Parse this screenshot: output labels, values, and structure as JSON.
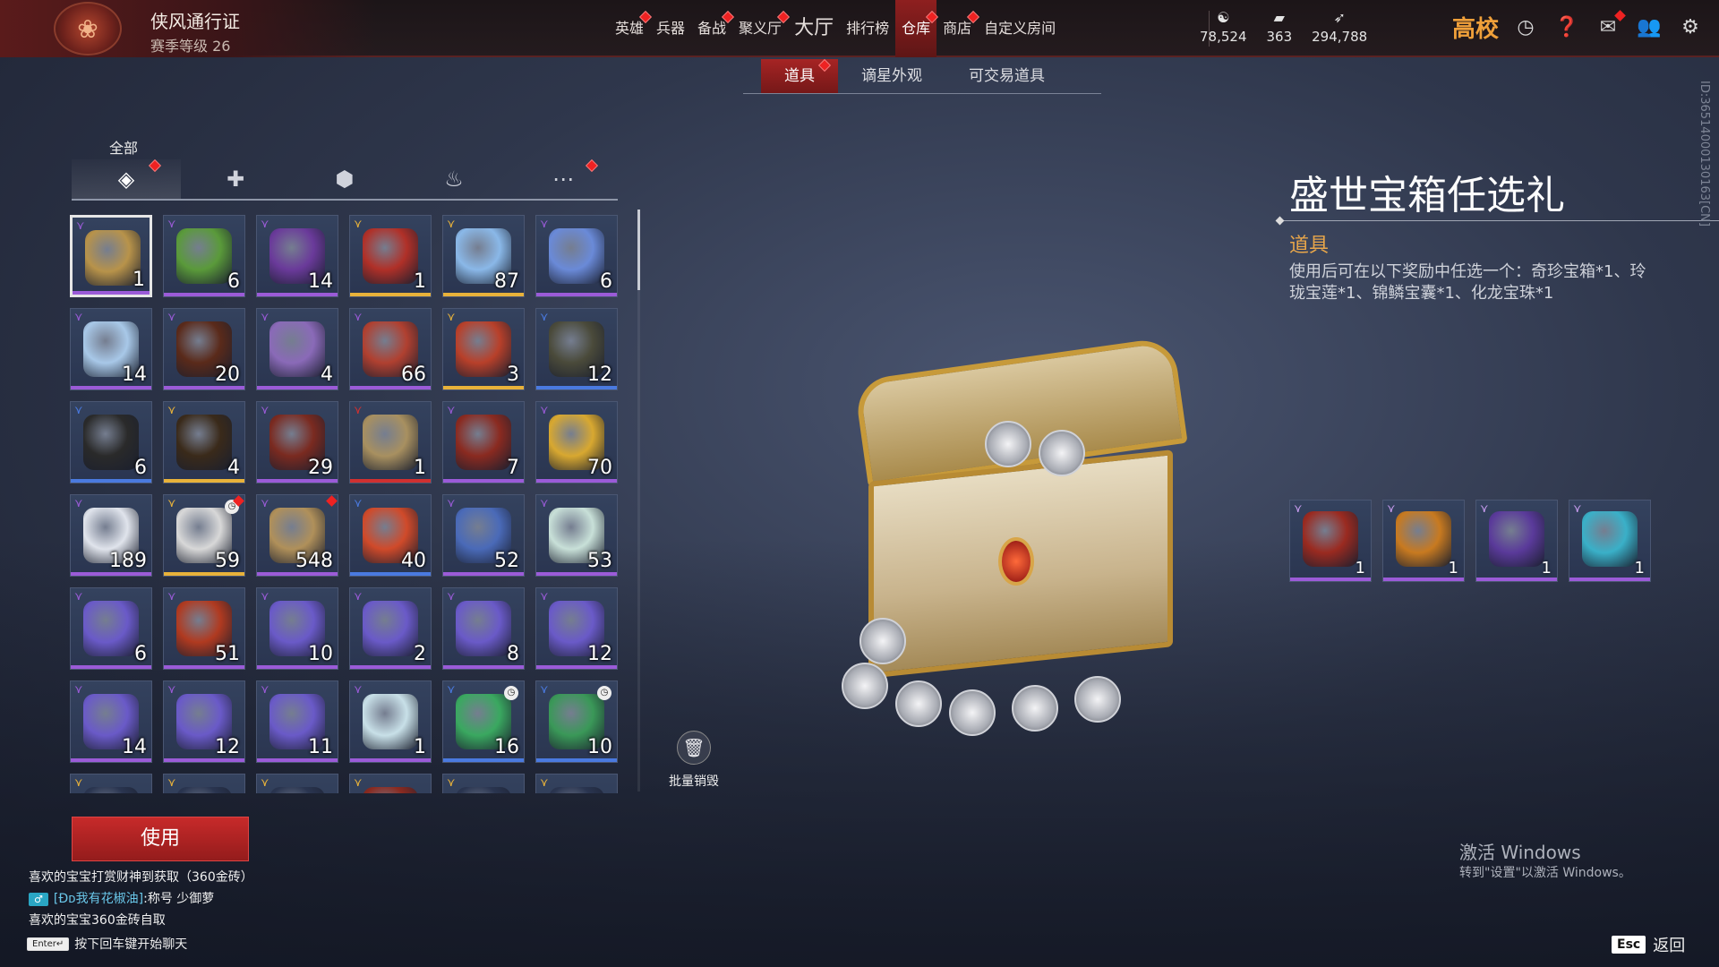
{
  "header": {
    "pass_title": "侠风通行证",
    "pass_level": "赛季等级 26",
    "nav": [
      {
        "label": "英雄",
        "dot": true,
        "active": false,
        "big": false
      },
      {
        "label": "兵器",
        "dot": false,
        "active": false,
        "big": false
      },
      {
        "label": "备战",
        "dot": true,
        "active": false,
        "big": false
      },
      {
        "label": "聚义厅",
        "dot": true,
        "active": false,
        "big": false
      },
      {
        "label": "大厅",
        "dot": false,
        "active": false,
        "big": true
      },
      {
        "label": "排行榜",
        "dot": false,
        "active": false,
        "big": false
      },
      {
        "label": "仓库",
        "dot": true,
        "active": true,
        "big": false
      },
      {
        "label": "商店",
        "dot": true,
        "active": false,
        "big": false
      },
      {
        "label": "自定义房间",
        "dot": false,
        "active": false,
        "big": false
      }
    ],
    "currencies": [
      {
        "icon": "mask-icon",
        "value": "78,524"
      },
      {
        "icon": "gold-ingot-icon",
        "value": "363"
      },
      {
        "icon": "feather-icon",
        "value": "294,788"
      }
    ],
    "brand": "高校"
  },
  "subtabs": [
    {
      "label": "道具",
      "active": true
    },
    {
      "label": "谪星外观",
      "active": false
    },
    {
      "label": "可交易道具",
      "active": false
    }
  ],
  "category": {
    "label": "全部",
    "tabs": [
      {
        "icon": "layers-icon",
        "glyph": "◈",
        "active": true,
        "dot": true
      },
      {
        "icon": "gift-icon",
        "glyph": "✚",
        "active": false,
        "dot": false
      },
      {
        "icon": "badge-icon",
        "glyph": "⬢",
        "active": false,
        "dot": false
      },
      {
        "icon": "flame-icon",
        "glyph": "♨",
        "active": false,
        "dot": false
      },
      {
        "icon": "more-icon",
        "glyph": "⋯",
        "active": false,
        "dot": true
      }
    ]
  },
  "inventory": [
    {
      "count": "1",
      "quality": "#9b5bd8",
      "color": "#b8934a",
      "selected": true
    },
    {
      "count": "6",
      "quality": "#9b5bd8",
      "color": "#5a9a3a"
    },
    {
      "count": "14",
      "quality": "#9b5bd8",
      "color": "#6a3a9a"
    },
    {
      "count": "1",
      "quality": "#e8b23a",
      "color": "#b03028"
    },
    {
      "count": "87",
      "quality": "#e8b23a",
      "color": "#8ab8e8"
    },
    {
      "count": "6",
      "quality": "#9b5bd8",
      "color": "#6a8ad8"
    },
    {
      "count": "14",
      "quality": "#9b5bd8",
      "color": "#a8c8e8"
    },
    {
      "count": "20",
      "quality": "#9b5bd8",
      "color": "#5a2a1a"
    },
    {
      "count": "4",
      "quality": "#9b5bd8",
      "color": "#8a6ab8"
    },
    {
      "count": "66",
      "quality": "#9b5bd8",
      "color": "#b04030"
    },
    {
      "count": "3",
      "quality": "#e8b23a",
      "color": "#b8402a"
    },
    {
      "count": "12",
      "quality": "#4a7ae0",
      "color": "#4a4a3a"
    },
    {
      "count": "6",
      "quality": "#4a7ae0",
      "color": "#2a2a2a"
    },
    {
      "count": "4",
      "quality": "#e8b23a",
      "color": "#3a2a1a"
    },
    {
      "count": "29",
      "quality": "#9b5bd8",
      "color": "#7a2a20"
    },
    {
      "count": "1",
      "quality": "#d03030",
      "color": "#a89060"
    },
    {
      "count": "7",
      "quality": "#9b5bd8",
      "color": "#8a2a20"
    },
    {
      "count": "70",
      "quality": "#9b5bd8",
      "color": "#d8a830"
    },
    {
      "count": "189",
      "quality": "#9b5bd8",
      "color": "#e0e4ec"
    },
    {
      "count": "59",
      "quality": "#e8b23a",
      "color": "#d8d8d8",
      "clock": true,
      "dot": true
    },
    {
      "count": "548",
      "quality": "#9b5bd8",
      "color": "#b0905a",
      "dot": true
    },
    {
      "count": "40",
      "quality": "#4a7ae0",
      "color": "#d04a2a"
    },
    {
      "count": "52",
      "quality": "#9b5bd8",
      "color": "#4a6ab8"
    },
    {
      "count": "53",
      "quality": "#9b5bd8",
      "color": "#c8e0d8"
    },
    {
      "count": "6",
      "quality": "#9b5bd8",
      "color": "#6a5ac8"
    },
    {
      "count": "51",
      "quality": "#9b5bd8",
      "color": "#b03a20"
    },
    {
      "count": "10",
      "quality": "#9b5bd8",
      "color": "#6a5ac8"
    },
    {
      "count": "2",
      "quality": "#9b5bd8",
      "color": "#6a5ac8"
    },
    {
      "count": "8",
      "quality": "#9b5bd8",
      "color": "#6a5ac8"
    },
    {
      "count": "12",
      "quality": "#9b5bd8",
      "color": "#6a5ac8"
    },
    {
      "count": "14",
      "quality": "#9b5bd8",
      "color": "#6a5ac8"
    },
    {
      "count": "12",
      "quality": "#9b5bd8",
      "color": "#6a5ac8"
    },
    {
      "count": "11",
      "quality": "#9b5bd8",
      "color": "#6a5ac8"
    },
    {
      "count": "1",
      "quality": "#9b5bd8",
      "color": "#c8e0e8"
    },
    {
      "count": "16",
      "quality": "#4a7ae0",
      "color": "#3aa860",
      "clock": true
    },
    {
      "count": "10",
      "quality": "#4a7ae0",
      "color": "#3a9858",
      "clock": true
    },
    {
      "count": "",
      "quality": "#e8b23a",
      "color": "#2a3550"
    },
    {
      "count": "",
      "quality": "#e8b23a",
      "color": "#2a3550"
    },
    {
      "count": "",
      "quality": "#e8b23a",
      "color": "#2a3550"
    },
    {
      "count": "",
      "quality": "#e8b23a",
      "color": "#8a2a20"
    },
    {
      "count": "",
      "quality": "#e8b23a",
      "color": "#2a3550"
    },
    {
      "count": "",
      "quality": "#e8b23a",
      "color": "#2a3550"
    }
  ],
  "batch_destroy": "批量销毁",
  "use_button": "使用",
  "chat": {
    "line1": "喜欢的宝宝打赏财神到获取（360金砖）",
    "line2_tag": "♂",
    "line2_name": "[Ðᴅ我有花椒油]",
    "line2_text": ":称号 少御萝",
    "line3": "喜欢的宝宝360金砖自取",
    "hint_key": "Enter↵",
    "hint": "按下回车键开始聊天"
  },
  "detail": {
    "title": "盛世宝箱任选礼",
    "type": "道具",
    "description": "使用后可在以下奖励中任选一个：奇珍宝箱*1、玲珑宝莲*1、锦鳞宝囊*1、化龙宝珠*1",
    "rewards": [
      {
        "count": "1",
        "color": "#9a2a20"
      },
      {
        "count": "1",
        "color": "#c87a20"
      },
      {
        "count": "1",
        "color": "#5a3a9a"
      },
      {
        "count": "1",
        "color": "#3ab0c8"
      }
    ]
  },
  "uid": "ID:3651400013016​3[CN]",
  "watermark": {
    "line1": "激活 Windows",
    "line2": "转到\"设置\"以激活 Windows。"
  },
  "esc": {
    "key": "Esc",
    "label": "返回"
  }
}
